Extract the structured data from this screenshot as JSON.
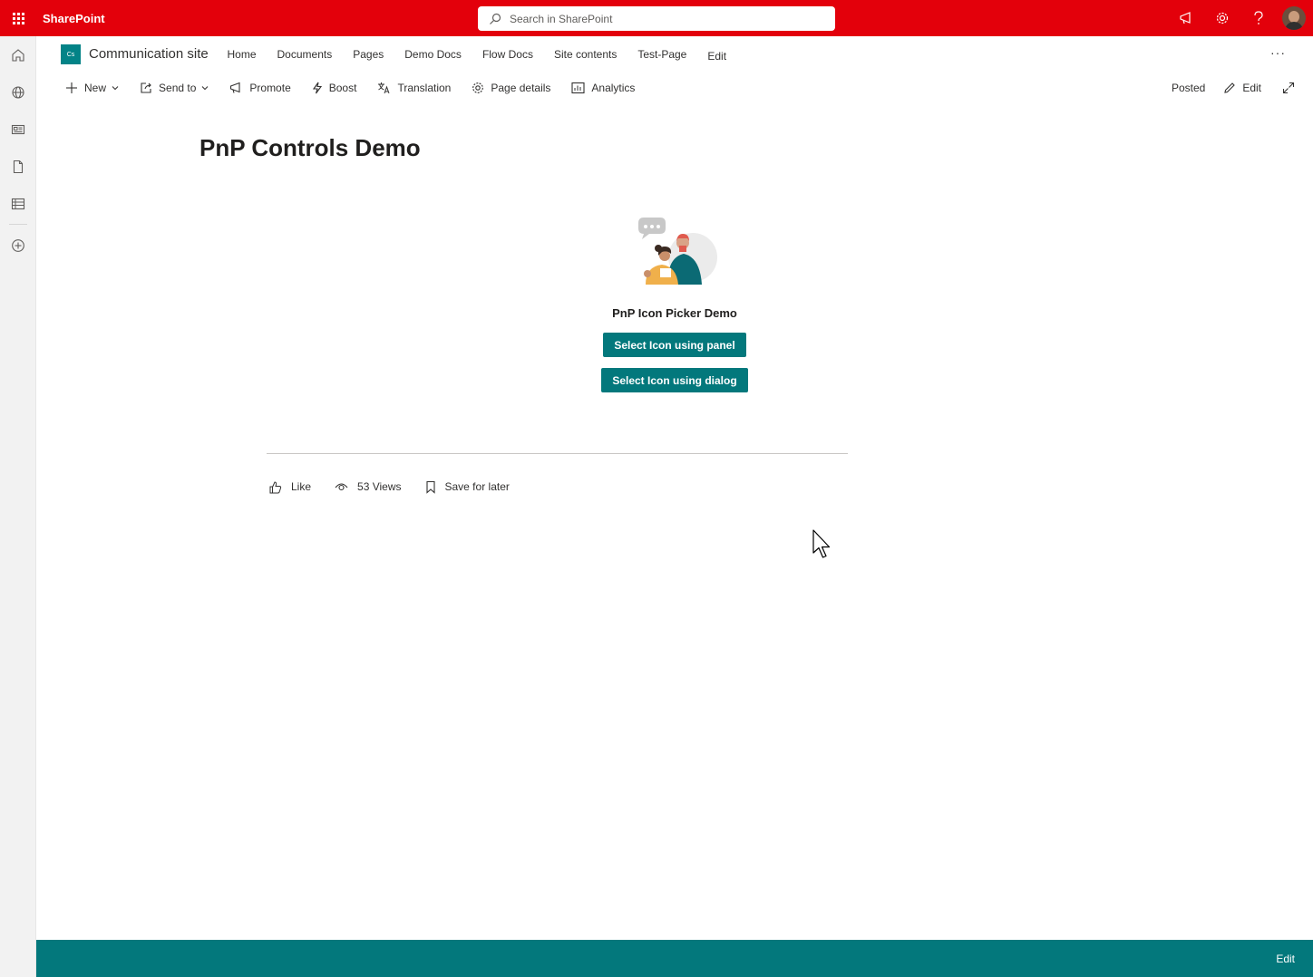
{
  "suitebar": {
    "brand": "SharePoint",
    "search_placeholder": "Search in SharePoint"
  },
  "site": {
    "logo_text": "Cs",
    "title": "Communication site",
    "nav": [
      "Home",
      "Documents",
      "Pages",
      "Demo Docs",
      "Flow Docs",
      "Site contents",
      "Test-Page",
      "Edit"
    ],
    "more": "···"
  },
  "commandbar": {
    "new": "New",
    "send_to": "Send to",
    "promote": "Promote",
    "boost": "Boost",
    "translation": "Translation",
    "page_details": "Page details",
    "analytics": "Analytics",
    "posted": "Posted",
    "edit": "Edit"
  },
  "page": {
    "title": "PnP Controls Demo",
    "webpart_title": "PnP Icon Picker Demo",
    "btn_panel": "Select Icon using panel",
    "btn_dialog": "Select Icon using dialog"
  },
  "social": {
    "like": "Like",
    "views": "53 Views",
    "save": "Save for later"
  },
  "footer": {
    "edit": "Edit"
  },
  "colors": {
    "suitebar": "#e3000b",
    "theme": "#03787c"
  }
}
